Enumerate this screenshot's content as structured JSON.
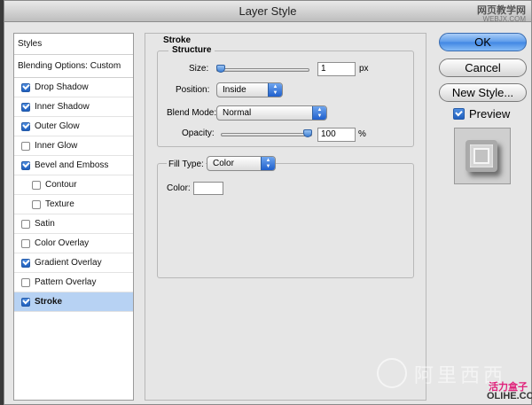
{
  "window": {
    "title": "Layer Style"
  },
  "watermark": {
    "top_cn": "网页教学网",
    "top_url": "WEBJX.COM",
    "bottom_cn": "阿里西西",
    "bottom_pink": "活力盒子",
    "bottom_site": "OLIHE.COM"
  },
  "styles": {
    "header": "Styles",
    "blending": "Blending Options: Custom",
    "items": [
      {
        "label": "Drop Shadow",
        "checked": true,
        "indent": false
      },
      {
        "label": "Inner Shadow",
        "checked": true,
        "indent": false
      },
      {
        "label": "Outer Glow",
        "checked": true,
        "indent": false
      },
      {
        "label": "Inner Glow",
        "checked": false,
        "indent": false
      },
      {
        "label": "Bevel and Emboss",
        "checked": true,
        "indent": false
      },
      {
        "label": "Contour",
        "checked": false,
        "indent": true
      },
      {
        "label": "Texture",
        "checked": false,
        "indent": true
      },
      {
        "label": "Satin",
        "checked": false,
        "indent": false
      },
      {
        "label": "Color Overlay",
        "checked": false,
        "indent": false
      },
      {
        "label": "Gradient Overlay",
        "checked": true,
        "indent": false
      },
      {
        "label": "Pattern Overlay",
        "checked": false,
        "indent": false
      },
      {
        "label": "Stroke",
        "checked": true,
        "indent": false,
        "selected": true
      }
    ]
  },
  "stroke": {
    "heading": "Stroke",
    "structure": {
      "legend": "Structure",
      "size_label": "Size:",
      "size_value": "1",
      "size_unit": "px",
      "size_slider_level": 0.0,
      "position_label": "Position:",
      "position_value": "Inside",
      "blend_label": "Blend Mode:",
      "blend_value": "Normal",
      "opacity_label": "Opacity:",
      "opacity_value": "100",
      "opacity_unit": "%",
      "opacity_slider_level": 1.0
    },
    "fill": {
      "type_label": "Fill Type:",
      "type_value": "Color",
      "color_label": "Color:",
      "color_value": "#ffffff"
    }
  },
  "buttons": {
    "ok": "OK",
    "cancel": "Cancel",
    "new_style": "New Style...",
    "preview_label": "Preview",
    "preview_checked": true
  }
}
